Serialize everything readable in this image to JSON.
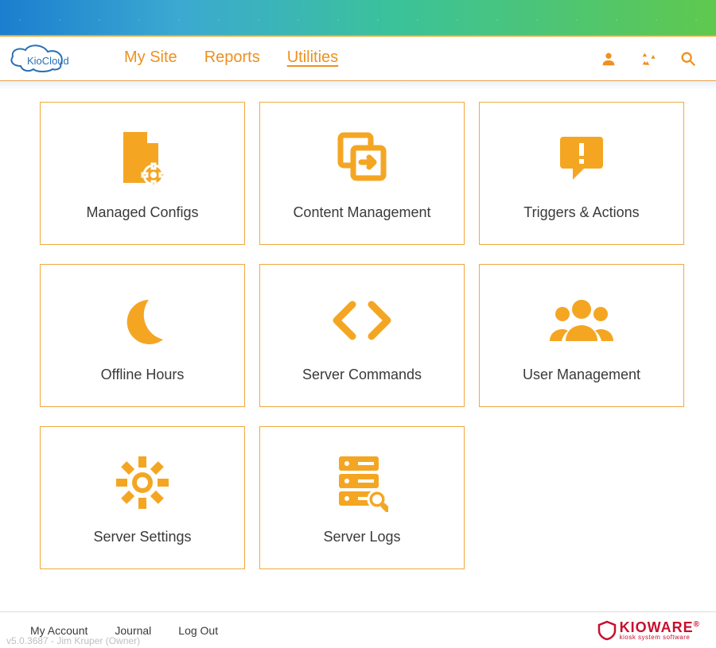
{
  "header": {
    "logo_text": "KioCloud",
    "nav": [
      {
        "label": "My Site",
        "active": false
      },
      {
        "label": "Reports",
        "active": false
      },
      {
        "label": "Utilities",
        "active": true
      }
    ],
    "icons": [
      "person-icon",
      "recycle-icon",
      "search-icon"
    ]
  },
  "tiles": [
    {
      "label": "Managed Configs",
      "icon": "file-gear-icon"
    },
    {
      "label": "Content Management",
      "icon": "copy-arrow-icon"
    },
    {
      "label": "Triggers & Actions",
      "icon": "alert-bubble-icon"
    },
    {
      "label": "Offline Hours",
      "icon": "moon-icon"
    },
    {
      "label": "Server Commands",
      "icon": "code-icon"
    },
    {
      "label": "User Management",
      "icon": "users-icon"
    },
    {
      "label": "Server Settings",
      "icon": "gear-icon"
    },
    {
      "label": "Server Logs",
      "icon": "server-icon"
    }
  ],
  "footer": {
    "links": [
      "My Account",
      "Journal",
      "Log Out"
    ],
    "meta": "v5.0.3687 - Jim Kruper (Owner)",
    "brand_main": "KIOWARE",
    "brand_sub": "kiosk system software"
  }
}
